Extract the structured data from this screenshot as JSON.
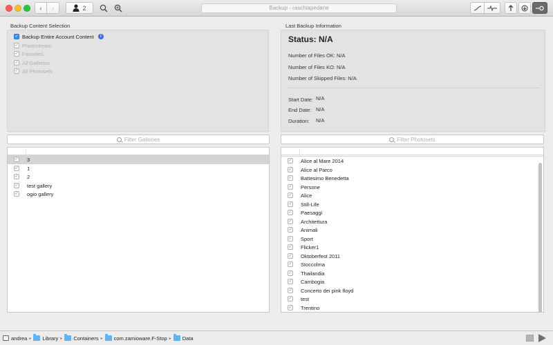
{
  "window": {
    "title": "Backup - raschiapedane"
  },
  "toolbar": {
    "user_count": "2",
    "nav_back_icon": "chevron-left-icon",
    "nav_forward_icon": "chevron-right-icon"
  },
  "left_panel": {
    "section_title": "Backup Content Selection",
    "options": [
      {
        "label": "Backup Entire Account Content",
        "checked": true,
        "enabled": true
      },
      {
        "label": "Photostream",
        "checked": true,
        "enabled": false
      },
      {
        "label": "Favorites",
        "checked": true,
        "enabled": false
      },
      {
        "label": "All Galleries",
        "checked": true,
        "enabled": false
      },
      {
        "label": "All Photosets",
        "checked": true,
        "enabled": false
      }
    ]
  },
  "right_panel": {
    "section_title": "Last Backup Information",
    "status": "Status: N/A",
    "files_ok": "Number of Files OK: N/A",
    "files_ko": "Number of Files KO: N/A",
    "files_skipped": "Number of Skipped Files: N/A",
    "start_date_label": "Start Date:",
    "start_date_value": "N/A",
    "end_date_label": "End Date:",
    "end_date_value": "N/A",
    "duration_label": "Duration:",
    "duration_value": "N/A"
  },
  "galleries": {
    "filter_placeholder": "Filter Galleries",
    "rows": [
      "3",
      "1",
      "2",
      "test gallery",
      "ogio gallery"
    ],
    "selected_index": 0
  },
  "photosets": {
    "filter_placeholder": "Filter Photosets",
    "rows": [
      "Alice al Mare 2014",
      "Alice al Parco",
      "Battesimo Benedetta",
      "Persone",
      "Alice",
      "Still-Life",
      "Paesaggi",
      "Architettura",
      "Animali",
      "Sport",
      "Flicker1",
      "Oktoberfest 2011",
      "Stoccolma",
      "Thailandia",
      "Cambogia",
      "Concerto dei pink floyd",
      "test",
      "Trentino"
    ]
  },
  "pathbar": {
    "items": [
      "andrea",
      "Library",
      "Containers",
      "com.zamioware.F-Stop",
      "Data"
    ]
  }
}
